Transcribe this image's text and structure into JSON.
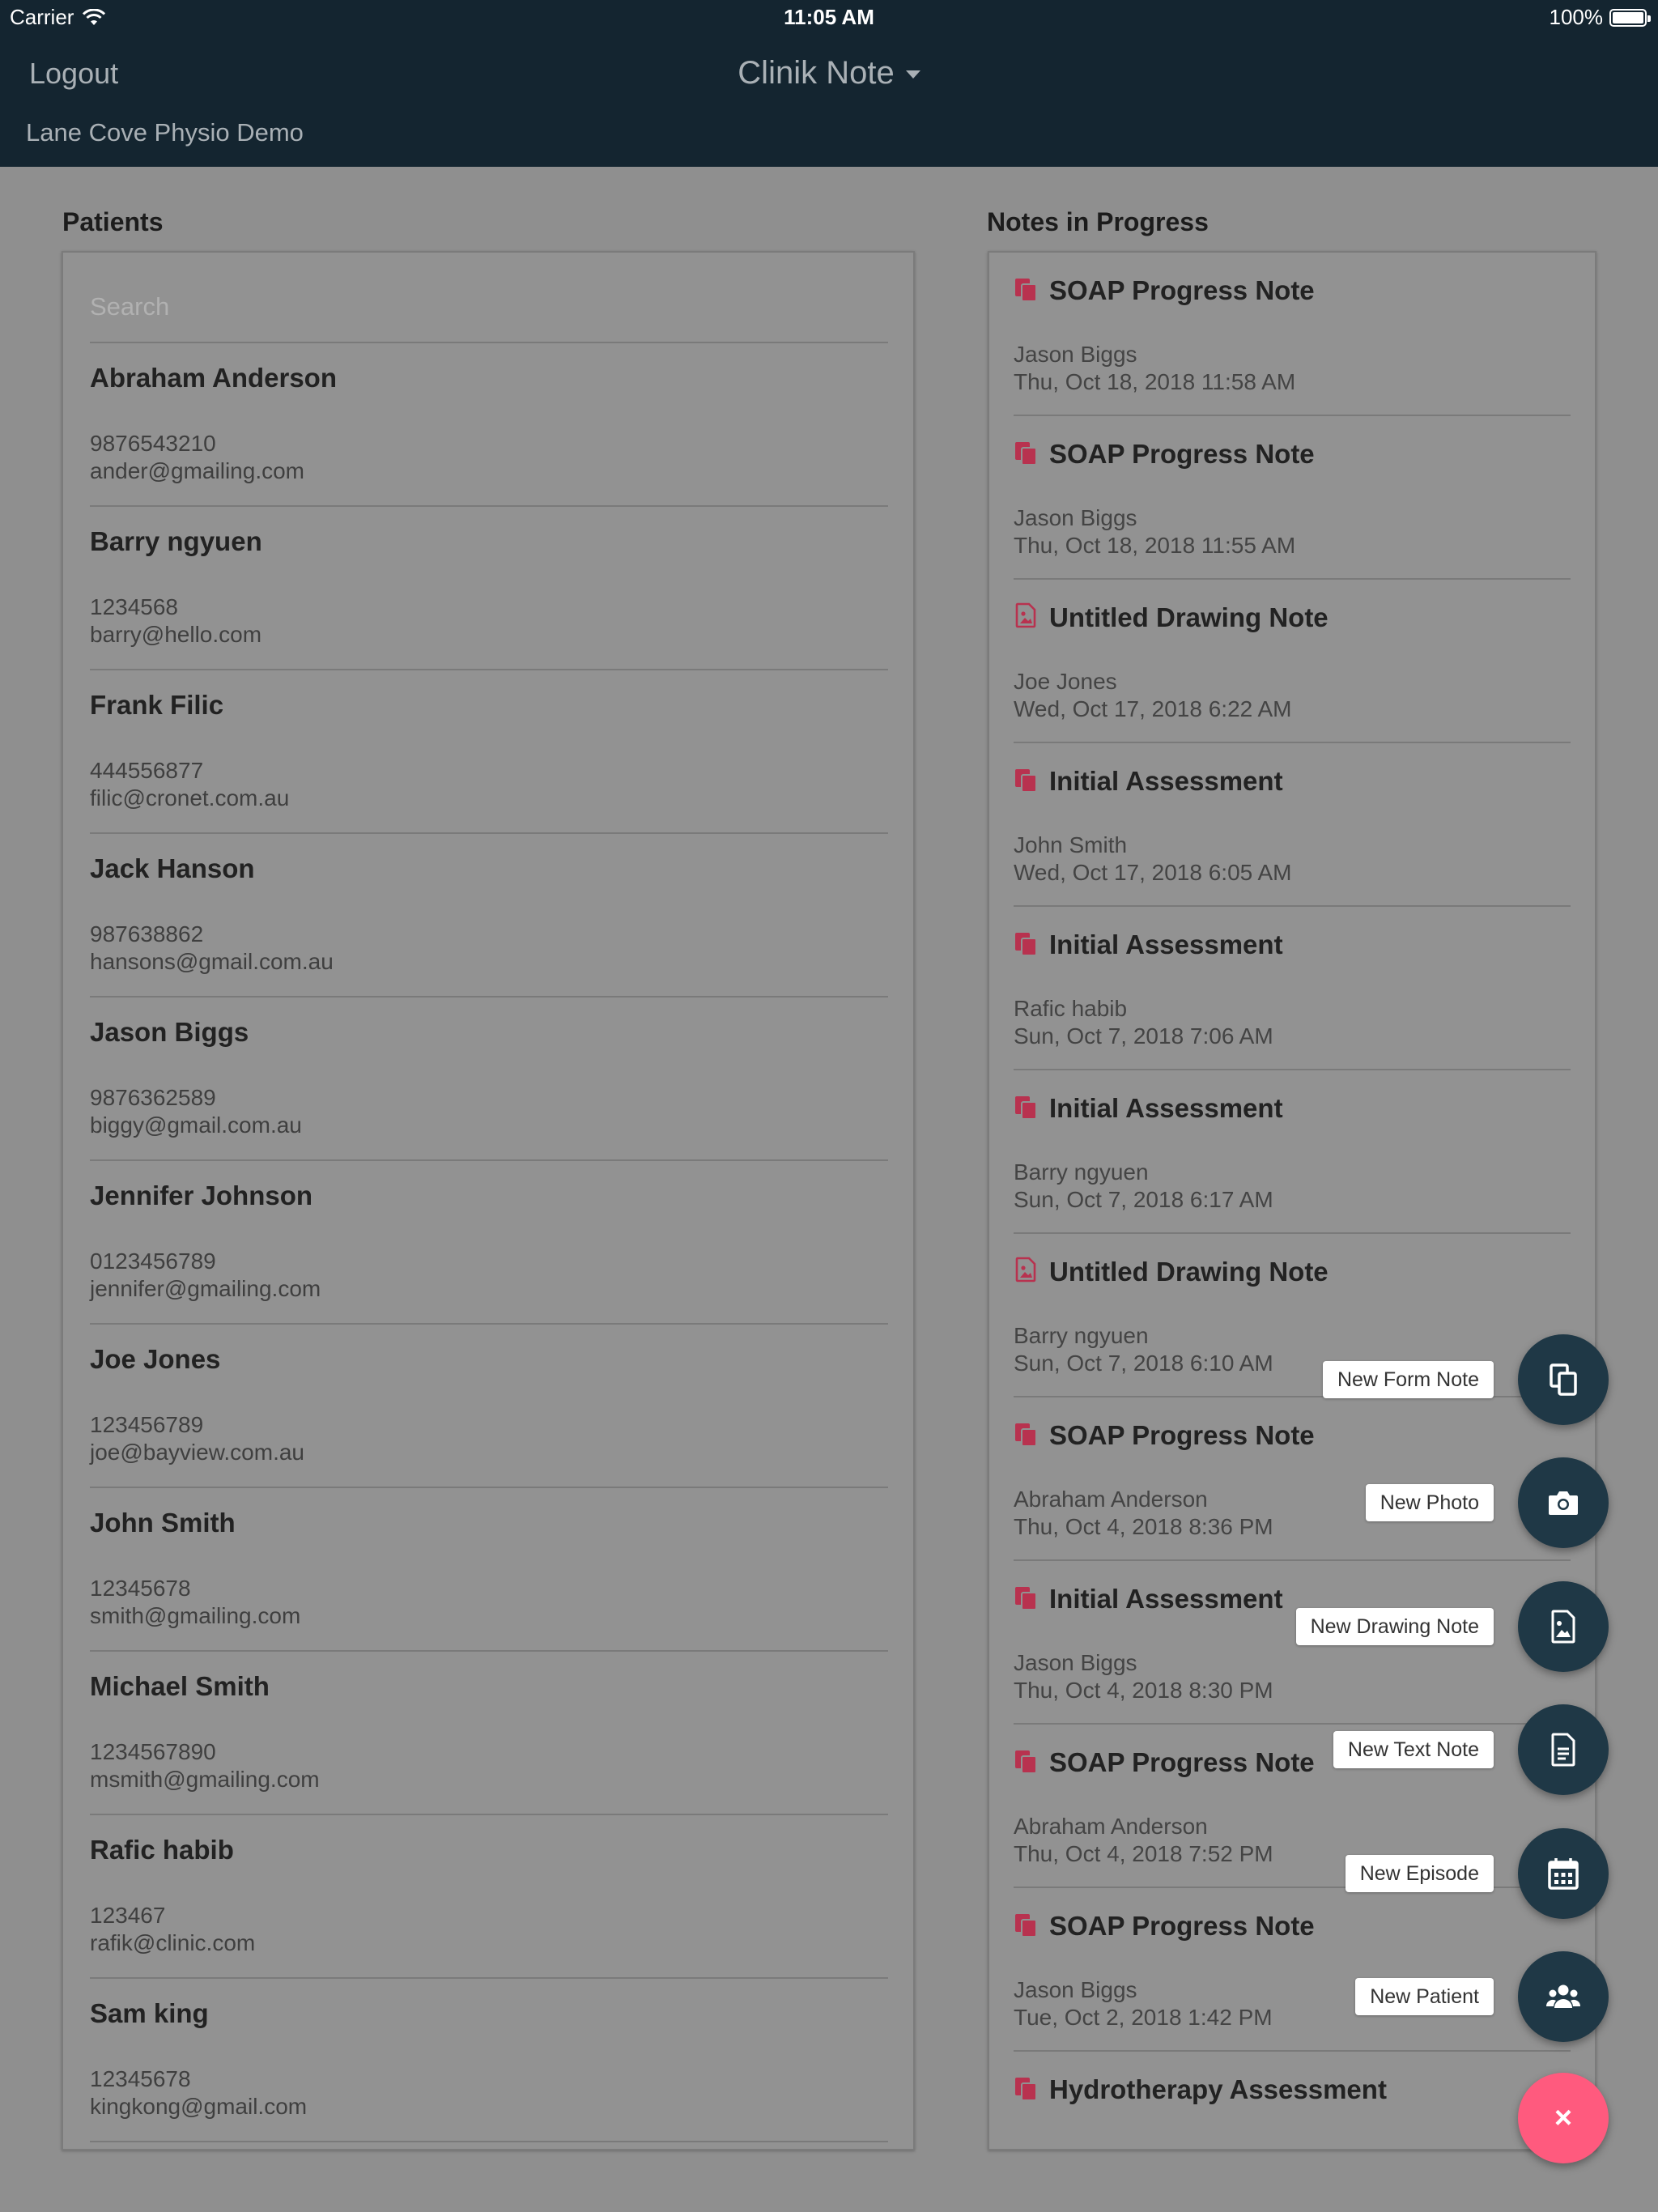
{
  "status_bar": {
    "carrier": "Carrier",
    "time": "11:05 AM",
    "battery": "100%"
  },
  "header": {
    "logout_label": "Logout",
    "app_title": "Clinik Note",
    "clinic_name": "Lane Cove Physio Demo"
  },
  "patients": {
    "title": "Patients",
    "search_placeholder": "Search",
    "items": [
      {
        "name": "Abraham Anderson",
        "phone": "9876543210",
        "email": "ander@gmailing.com"
      },
      {
        "name": "Barry ngyuen",
        "phone": "1234568",
        "email": "barry@hello.com"
      },
      {
        "name": "Frank Filic",
        "phone": "444556877",
        "email": "filic@cronet.com.au"
      },
      {
        "name": "Jack Hanson",
        "phone": "987638862",
        "email": "hansons@gmail.com.au"
      },
      {
        "name": "Jason Biggs",
        "phone": "9876362589",
        "email": "biggy@gmail.com.au"
      },
      {
        "name": "Jennifer Johnson",
        "phone": "0123456789",
        "email": "jennifer@gmailing.com"
      },
      {
        "name": "Joe Jones",
        "phone": "123456789",
        "email": "joe@bayview.com.au"
      },
      {
        "name": "John Smith",
        "phone": "12345678",
        "email": "smith@gmailing.com"
      },
      {
        "name": "Michael Smith",
        "phone": "1234567890",
        "email": "msmith@gmailing.com"
      },
      {
        "name": "Rafic habib",
        "phone": "123467",
        "email": "rafik@clinic.com"
      },
      {
        "name": "Sam king",
        "phone": "12345678",
        "email": "kingkong@gmail.com"
      }
    ]
  },
  "notes": {
    "title": "Notes in Progress",
    "items": [
      {
        "type": "form",
        "title": "SOAP Progress Note",
        "patient": "Jason Biggs",
        "date": "Thu, Oct 18, 2018 11:58 AM"
      },
      {
        "type": "form",
        "title": "SOAP Progress Note",
        "patient": "Jason Biggs",
        "date": "Thu, Oct 18, 2018 11:55 AM"
      },
      {
        "type": "drawing",
        "title": "Untitled Drawing Note",
        "patient": "Joe Jones",
        "date": "Wed, Oct 17, 2018 6:22 AM"
      },
      {
        "type": "form",
        "title": "Initial Assessment",
        "patient": "John Smith",
        "date": "Wed, Oct 17, 2018 6:05 AM"
      },
      {
        "type": "form",
        "title": "Initial Assessment",
        "patient": "Rafic habib",
        "date": "Sun, Oct 7, 2018 7:06 AM"
      },
      {
        "type": "form",
        "title": "Initial Assessment",
        "patient": "Barry ngyuen",
        "date": "Sun, Oct 7, 2018 6:17 AM"
      },
      {
        "type": "drawing",
        "title": "Untitled Drawing Note",
        "patient": "Barry ngyuen",
        "date": "Sun, Oct 7, 2018 6:10 AM"
      },
      {
        "type": "form",
        "title": "SOAP Progress Note",
        "patient": "Abraham Anderson",
        "date": "Thu, Oct 4, 2018 8:36 PM"
      },
      {
        "type": "form",
        "title": "Initial Assessment",
        "patient": "Jason Biggs",
        "date": "Thu, Oct 4, 2018 8:30 PM"
      },
      {
        "type": "form",
        "title": "SOAP Progress Note",
        "patient": "Abraham Anderson",
        "date": "Thu, Oct 4, 2018 7:52 PM"
      },
      {
        "type": "form",
        "title": "SOAP Progress Note",
        "patient": "Jason Biggs",
        "date": "Tue, Oct 2, 2018 1:42 PM"
      },
      {
        "type": "form",
        "title": "Hydrotherapy Assessment",
        "patient": "",
        "date": ""
      }
    ]
  },
  "fab_menu": {
    "actions": [
      {
        "label": "New Form Note",
        "icon": "clipboard-copy-icon"
      },
      {
        "label": "New Photo",
        "icon": "camera-icon"
      },
      {
        "label": "New Drawing Note",
        "icon": "image-file-icon"
      },
      {
        "label": "New Text Note",
        "icon": "text-file-icon"
      },
      {
        "label": "New Episode",
        "icon": "calendar-icon"
      },
      {
        "label": "New Patient",
        "icon": "users-icon"
      }
    ],
    "close_glyph": "×"
  },
  "colors": {
    "header_bg": "#142530",
    "fab_bg": "#1f3846",
    "fab_close_bg": "#ff5a7e",
    "note_icon": "#b8324f",
    "overlay_bg": "#8f8f8f"
  }
}
